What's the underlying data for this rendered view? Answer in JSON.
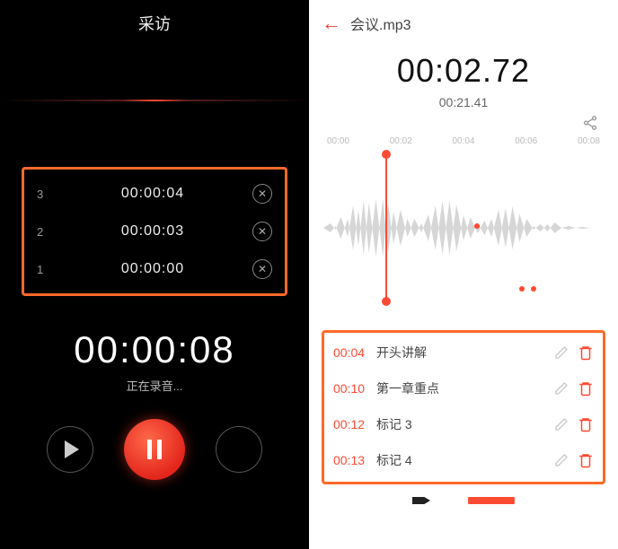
{
  "left": {
    "title": "采访",
    "marks": [
      {
        "index": "3",
        "time": "00:00:04"
      },
      {
        "index": "2",
        "time": "00:00:03"
      },
      {
        "index": "1",
        "time": "00:00:00"
      }
    ],
    "timer": "00:00:08",
    "status": "正在录音...",
    "icons": {
      "play": "play-icon",
      "pause": "pause-icon",
      "delete_mark": "close-icon"
    }
  },
  "right": {
    "file": "会议.mp3",
    "current_time": "00:02.72",
    "total_time": "00:21.41",
    "ticks": [
      "00:00",
      "00:02",
      "00:04",
      "00:06",
      "00:08"
    ],
    "segments": [
      {
        "t": "00:04",
        "label": "开头讲解"
      },
      {
        "t": "00:10",
        "label": "第一章重点"
      },
      {
        "t": "00:12",
        "label": "标记 3"
      },
      {
        "t": "00:13",
        "label": "标记 4"
      }
    ],
    "icons": {
      "back": "arrow-left-icon",
      "share": "share-icon",
      "edit": "pencil-icon",
      "delete": "trash-icon",
      "play": "play-icon",
      "stop": "stop-icon"
    }
  },
  "colors": {
    "accent": "#ff4a33",
    "box": "#ff6a2a"
  }
}
